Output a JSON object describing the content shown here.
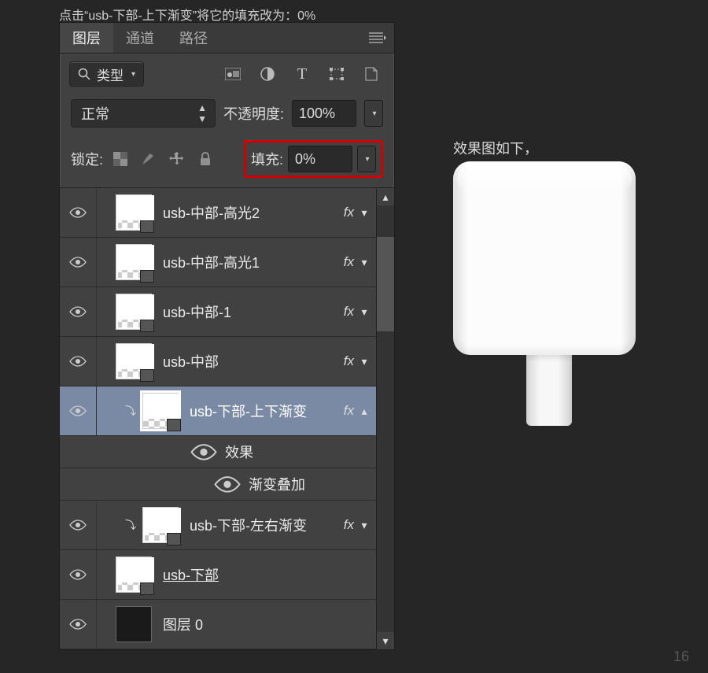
{
  "instruction": "点击“usb-下部-上下渐变”将它的填充改为：0%",
  "panel": {
    "tabs": {
      "layers": "图层",
      "channels": "通道",
      "paths": "路径"
    },
    "filterLabel": "类型",
    "blendMode": "正常",
    "opacityLabel": "不透明度:",
    "opacityValue": "100%",
    "lockLabel": "锁定:",
    "fillLabel": "填充:",
    "fillValue": "0%"
  },
  "layers": [
    {
      "name": "usb-中部-高光2",
      "fx": true,
      "indent": 1,
      "eye": true,
      "expand": "down"
    },
    {
      "name": "usb-中部-高光1",
      "fx": true,
      "indent": 1,
      "eye": true,
      "expand": "down"
    },
    {
      "name": "usb-中部-1",
      "fx": true,
      "indent": 1,
      "eye": true,
      "expand": "down"
    },
    {
      "name": "usb-中部",
      "fx": true,
      "indent": 1,
      "eye": true,
      "expand": "down"
    },
    {
      "name": "usb-下部-上下渐变",
      "fx": true,
      "indent": 2,
      "eye": true,
      "selected": true,
      "clip": true,
      "expand": "up"
    },
    {
      "name": "usb-下部-左右渐变",
      "fx": true,
      "indent": 2,
      "eye": true,
      "clip": true,
      "expand": "down"
    },
    {
      "name": "usb-下部",
      "fx": false,
      "indent": 1,
      "eye": true,
      "underline": true
    },
    {
      "name": "图层 0",
      "fx": false,
      "indent": 1,
      "eye": true,
      "solid": true
    }
  ],
  "effects": {
    "title": "效果",
    "gradientOverlay": "渐变叠加"
  },
  "preview": {
    "label": "效果图如下，"
  },
  "pageNumber": "16"
}
